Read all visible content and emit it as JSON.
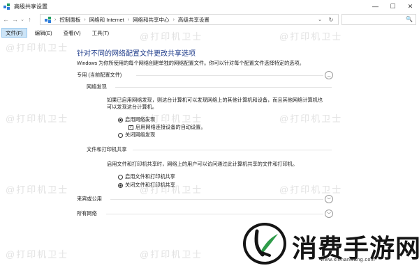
{
  "window": {
    "title": "高级共享设置",
    "app_icon": "network-sharing-icon",
    "controls": {
      "minimize": "—",
      "maximize": "☐",
      "close": "✕"
    }
  },
  "nav": {
    "back": "←",
    "forward": "→",
    "recent": "⌄",
    "up": "↑",
    "breadcrumbs": [
      "控制面板",
      "网络和 Internet",
      "网络和共享中心",
      "高级共享设置"
    ],
    "dropdown": "⌄",
    "refresh": "↻",
    "search_placeholder": "",
    "search_icon": "🔍"
  },
  "menu": [
    {
      "label": "文件(F)",
      "active": true
    },
    {
      "label": "编辑(E)",
      "active": false
    },
    {
      "label": "查看(V)",
      "active": false
    },
    {
      "label": "工具(T)",
      "active": false
    }
  ],
  "main": {
    "heading": "针对不同的网络配置文件更改共享选项",
    "intro": "Windows 为你所使用的每个网络创建单独的网络配置文件。你可以针对每个配置文件选择特定的选项。",
    "profile_private": "专用 (当前配置文件)",
    "network_discovery": {
      "title": "网络发现",
      "desc_line1": "如果已启用网络发现，则这台计算机可以发现网络上的其他计算机和设备，而且其他网络计算机也",
      "desc_line2": "可以发现这台计算机。",
      "opt_on": "启用网络发现",
      "opt_auto": "启用网络连接设备的自动设置。",
      "opt_off": "关闭网络发现"
    },
    "file_printer": {
      "title": "文件和打印机共享",
      "desc": "启用文件和打印机共享时，网络上的用户可以访问通过此计算机共享的文件和打印机。",
      "opt_on": "启用文件和打印机共享",
      "opt_off": "关闭文件和打印机共享"
    },
    "profile_guest": "来宾或公用",
    "profile_all": "所有网络"
  },
  "watermark": "@打印机卫士",
  "brand": {
    "name": "消费手游网",
    "url": "www.xinnanwang.com"
  }
}
